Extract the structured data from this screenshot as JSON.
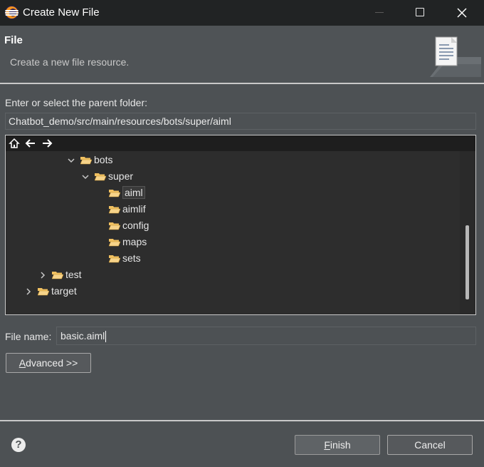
{
  "window": {
    "title": "Create New File"
  },
  "header": {
    "title": "File",
    "description": "Create a new file resource.",
    "image": "new-file-wizard-icon"
  },
  "parent_folder": {
    "label": "Enter or select the parent folder:",
    "value": "Chatbot_demo/src/main/resources/bots/super/aiml"
  },
  "tree_toolbar": {
    "icons": [
      "home-icon",
      "back-arrow-icon",
      "forward-arrow-icon"
    ]
  },
  "tree": {
    "items": [
      {
        "label": "bots",
        "state": "expanded",
        "selected": false
      },
      {
        "label": "super",
        "state": "expanded",
        "selected": false
      },
      {
        "label": "aiml",
        "state": "leaf",
        "selected": true
      },
      {
        "label": "aimlif",
        "state": "leaf",
        "selected": false
      },
      {
        "label": "config",
        "state": "leaf",
        "selected": false
      },
      {
        "label": "maps",
        "state": "leaf",
        "selected": false
      },
      {
        "label": "sets",
        "state": "leaf",
        "selected": false
      },
      {
        "label": "test",
        "state": "collapsed",
        "selected": false
      },
      {
        "label": "target",
        "state": "collapsed",
        "selected": false
      }
    ]
  },
  "file_name": {
    "label": "File name:",
    "value": "basic.aiml"
  },
  "buttons": {
    "advanced": {
      "mnemonic": "A",
      "rest": "dvanced >>"
    },
    "finish": {
      "mnemonic": "F",
      "rest": "inish"
    },
    "cancel": "Cancel",
    "help": "?"
  },
  "colors": {
    "background": "#4d5154",
    "tree_background": "#2d2d2d",
    "titlebar": "#212324",
    "folder": "#f0c060"
  }
}
